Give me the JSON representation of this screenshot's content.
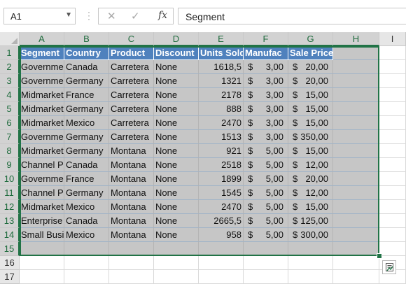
{
  "name_box": {
    "value": "A1"
  },
  "formula_bar": {
    "cancel_icon": "x-icon",
    "enter_icon": "check-icon",
    "function_label": "fx",
    "content": "Segment"
  },
  "columns": [
    "A",
    "B",
    "C",
    "D",
    "E",
    "F",
    "G",
    "H",
    "I"
  ],
  "rows": [
    "1",
    "2",
    "3",
    "4",
    "5",
    "6",
    "7",
    "8",
    "9",
    "10",
    "11",
    "12",
    "13",
    "14",
    "15",
    "16",
    "17"
  ],
  "table": {
    "headers": [
      "Segment",
      "Country",
      "Product",
      "Discount",
      "Units Sold",
      "Manufac",
      "Sale Price"
    ],
    "rows": [
      [
        "Government",
        "Canada",
        "Carretera",
        "None",
        "1618,5",
        "$",
        "3,00",
        "$",
        "20,00"
      ],
      [
        "Government",
        "Germany",
        "Carretera",
        "None",
        "1321",
        "$",
        "3,00",
        "$",
        "20,00"
      ],
      [
        "Midmarket",
        "France",
        "Carretera",
        "None",
        "2178",
        "$",
        "3,00",
        "$",
        "15,00"
      ],
      [
        "Midmarket",
        "Germany",
        "Carretera",
        "None",
        "888",
        "$",
        "3,00",
        "$",
        "15,00"
      ],
      [
        "Midmarket",
        "Mexico",
        "Carretera",
        "None",
        "2470",
        "$",
        "3,00",
        "$",
        "15,00"
      ],
      [
        "Government",
        "Germany",
        "Carretera",
        "None",
        "1513",
        "$",
        "3,00",
        "$",
        "350,00"
      ],
      [
        "Midmarket",
        "Germany",
        "Montana",
        "None",
        "921",
        "$",
        "5,00",
        "$",
        "15,00"
      ],
      [
        "Channel Partners",
        "Canada",
        "Montana",
        "None",
        "2518",
        "$",
        "5,00",
        "$",
        "12,00"
      ],
      [
        "Government",
        "France",
        "Montana",
        "None",
        "1899",
        "$",
        "5,00",
        "$",
        "20,00"
      ],
      [
        "Channel Partners",
        "Germany",
        "Montana",
        "None",
        "1545",
        "$",
        "5,00",
        "$",
        "12,00"
      ],
      [
        "Midmarket",
        "Mexico",
        "Montana",
        "None",
        "2470",
        "$",
        "5,00",
        "$",
        "15,00"
      ],
      [
        "Enterprise",
        "Canada",
        "Montana",
        "None",
        "2665,5",
        "$",
        "5,00",
        "$",
        "125,00"
      ],
      [
        "Small Business",
        "Mexico",
        "Montana",
        "None",
        "958",
        "$",
        "5,00",
        "$",
        "300,00"
      ]
    ]
  },
  "colors": {
    "header_fill": "#4f81bd",
    "selection_fill": "#c6c6c6",
    "selection_border": "#217346"
  },
  "quick_analysis_icon": "quick-analysis-icon"
}
